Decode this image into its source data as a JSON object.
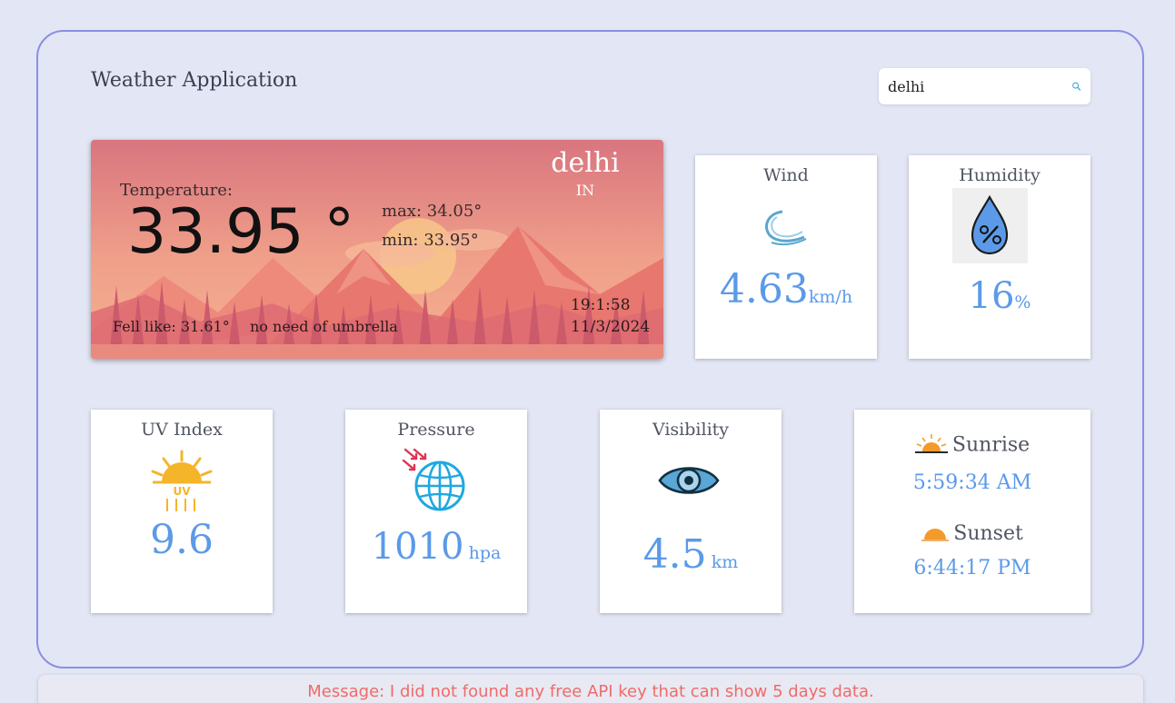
{
  "app": {
    "title": "Weather Application"
  },
  "search": {
    "value": "delhi",
    "placeholder": ""
  },
  "current": {
    "temperature_label": "Temperature:",
    "temperature": "33.95 °",
    "max": "max: 34.05°",
    "min": "min: 33.95°",
    "city": "delhi",
    "country": "IN",
    "feels_like": "Fell like: 31.61°",
    "umbrella": "no need of umbrella",
    "time": "19:1:58",
    "date": "11/3/2024"
  },
  "wind": {
    "title": "Wind",
    "value": "4.63",
    "unit": "km/h",
    "icon": "wind-icon"
  },
  "humidity": {
    "title": "Humidity",
    "value": "16",
    "unit": "%",
    "icon": "humidity-drop-icon"
  },
  "uv": {
    "title": "UV Index",
    "value": "9.6",
    "icon": "uv-sun-icon"
  },
  "pressure": {
    "title": "Pressure",
    "value": "1010",
    "unit": "hpa",
    "icon": "pressure-globe-icon"
  },
  "visibility": {
    "title": "Visibility",
    "value": "4.5",
    "unit": "km",
    "icon": "eye-icon"
  },
  "sun": {
    "sunrise_label": "Sunrise",
    "sunrise_time": "5:59:34 AM",
    "sunset_label": "Sunset",
    "sunset_time": "6:44:17 PM"
  },
  "message": "Message: I did not found any free API key that can show 5 days data.",
  "colors": {
    "accent": "#5b9ae8",
    "frame": "#8a8fe0",
    "background": "#e3e6f5",
    "message": "#ef6b6b"
  }
}
